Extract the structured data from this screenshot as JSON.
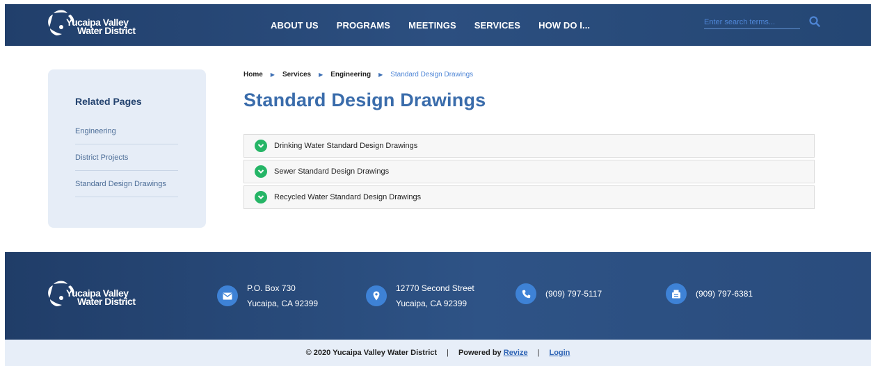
{
  "header": {
    "logo_line1": "Yucaipa Valley",
    "logo_line2": "Water District",
    "nav": [
      "ABOUT US",
      "PROGRAMS",
      "MEETINGS",
      "SERVICES",
      "HOW DO I..."
    ],
    "search_placeholder": "Enter search terms...",
    "search_icon": "search-icon"
  },
  "sidebar": {
    "title": "Related Pages",
    "items": [
      "Engineering",
      "District Projects",
      "Standard Design Drawings"
    ]
  },
  "breadcrumb": {
    "items": [
      "Home",
      "Services",
      "Engineering"
    ],
    "current": "Standard Design Drawings"
  },
  "page_title": "Standard Design Drawings",
  "accordion": [
    "Drinking Water Standard Design Drawings",
    "Sewer Standard Design Drawings",
    "Recycled Water Standard Design Drawings"
  ],
  "footer": {
    "logo_line1": "Yucaipa Valley",
    "logo_line2": "Water District",
    "mail": {
      "icon": "envelope-icon",
      "line1": "P.O. Box 730",
      "line2": "Yucaipa, CA 92399"
    },
    "address": {
      "icon": "map-pin-icon",
      "line1": "12770 Second Street",
      "line2": "Yucaipa, CA 92399"
    },
    "phone": {
      "icon": "phone-icon",
      "line1": "(909) 797-5117"
    },
    "fax": {
      "icon": "fax-icon",
      "line1": "(909) 797-6381"
    }
  },
  "bottombar": {
    "copyright": "© 2020 Yucaipa Valley Water District",
    "powered_by": "Powered by",
    "revize": "Revize",
    "login": "Login"
  },
  "colors": {
    "header_bg": "#2c4f80",
    "accent_blue": "#3a6cab",
    "chevron_green": "#25b566",
    "sidebar_bg": "#e6edf7"
  }
}
